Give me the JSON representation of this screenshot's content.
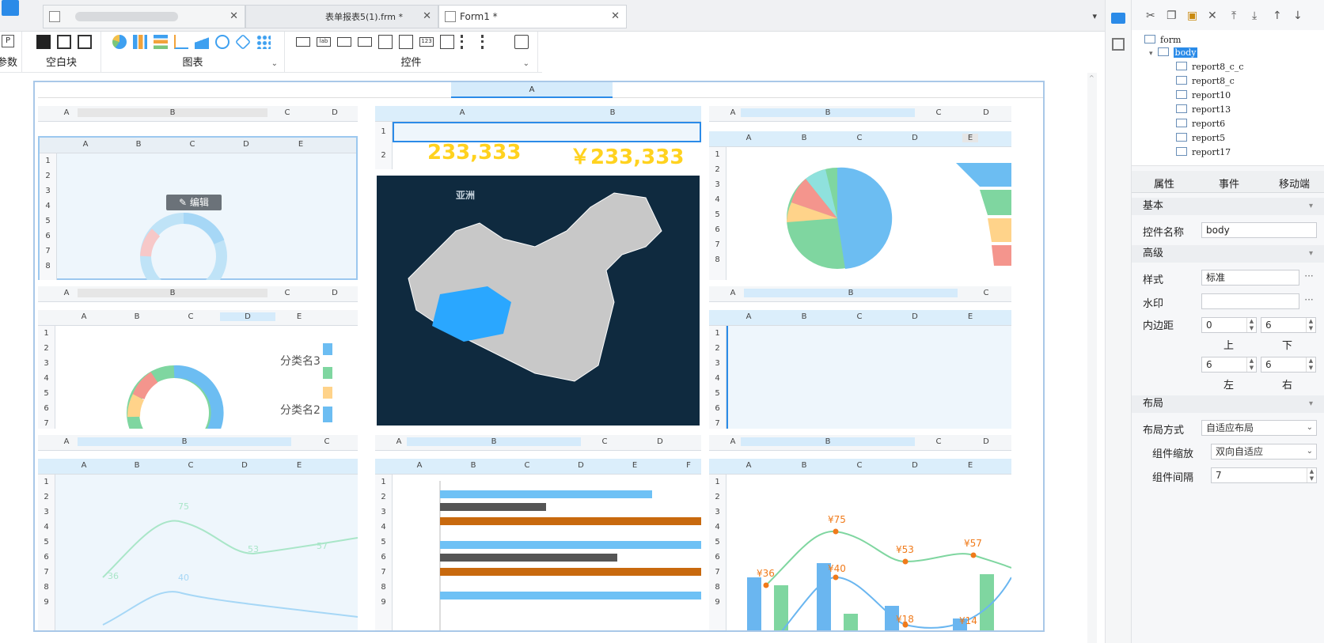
{
  "tabs": [
    {
      "label": "",
      "active": false
    },
    {
      "label": "表单报表5(1).frm *",
      "active": false
    },
    {
      "label": "Form1 *",
      "active": true
    }
  ],
  "ribbon": {
    "param_label": "参数",
    "groups": [
      {
        "label": "空白块"
      },
      {
        "label": "图表"
      },
      {
        "label": "控件"
      }
    ]
  },
  "canvas": {
    "top_header_col": "A",
    "edit_label": "编辑",
    "metric1": "233,333",
    "metric2": "￥233,333",
    "map_label": "亚洲",
    "cat3": "分类名3",
    "cat2": "分类名2",
    "line_labels_left": [
      "75",
      "53",
      "57",
      "36",
      "40"
    ],
    "combo_labels": [
      "¥75",
      "¥53",
      "¥57",
      "¥36",
      "¥40",
      "¥18",
      "¥14"
    ]
  },
  "tree": {
    "root": "form",
    "body": "body",
    "children": [
      "report8_c_c",
      "report8_c",
      "report10",
      "report13",
      "report6",
      "report5",
      "report17"
    ]
  },
  "props": {
    "tabs": [
      "属性",
      "事件",
      "移动端"
    ],
    "sec_basic": "基本",
    "widget_name_label": "控件名称",
    "widget_name_value": "body",
    "sec_adv": "高级",
    "style_label": "样式",
    "style_value": "标准",
    "watermark_label": "水印",
    "padding_label": "内边距",
    "pad_top": "0",
    "pad_bottom": "6",
    "pad_left": "6",
    "pad_right": "6",
    "lbl_top": "上",
    "lbl_bottom": "下",
    "lbl_left": "左",
    "lbl_right": "右",
    "sec_layout": "布局",
    "layout_mode_label": "布局方式",
    "layout_mode_value": "自适应布局",
    "scale_label": "组件缩放",
    "scale_value": "双向自适应",
    "gap_label": "组件间隔",
    "gap_value": "7"
  },
  "colors": {
    "accent": "#2b8be8",
    "map_bg": "#0f2a3f",
    "highlight": "#2aa7ff",
    "metric": "#ffd21f",
    "bar_blue": "#6ec1f5",
    "bar_dark": "#555555",
    "bar_orange": "#c8690e"
  }
}
